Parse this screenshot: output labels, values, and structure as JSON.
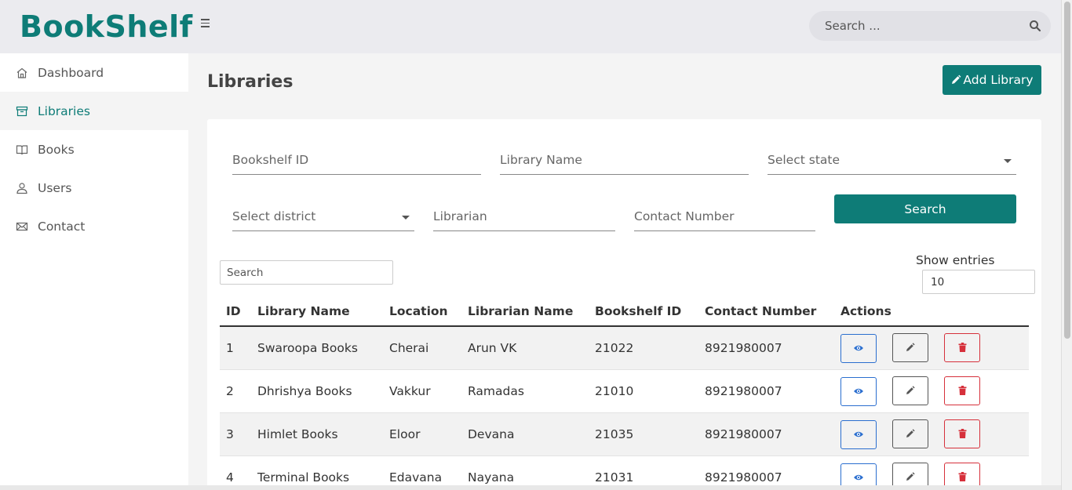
{
  "app": {
    "logo": "BookShelf",
    "brand_color": "#0e7c77"
  },
  "header": {
    "search_placeholder": "Search ..."
  },
  "sidebar": {
    "items": [
      {
        "label": "Dashboard",
        "icon": "home-icon",
        "active": false
      },
      {
        "label": "Libraries",
        "icon": "archive-icon",
        "active": true
      },
      {
        "label": "Books",
        "icon": "book-icon",
        "active": false
      },
      {
        "label": "Users",
        "icon": "user-icon",
        "active": false
      },
      {
        "label": "Contact",
        "icon": "mail-icon",
        "active": false
      }
    ]
  },
  "page": {
    "title": "Libraries",
    "add_button": "Add Library"
  },
  "filters": {
    "bookshelf_id": "Bookshelf ID",
    "library_name": "Library Name",
    "state": "Select state",
    "district": "Select district",
    "librarian": "Librarian",
    "contact": "Contact Number",
    "search_button": "Search"
  },
  "table_controls": {
    "search_placeholder": "Search",
    "show_entries_label": "Show entries",
    "show_entries_value": "10"
  },
  "table": {
    "columns": [
      "ID",
      "Library Name",
      "Location",
      "Librarian Name",
      "Bookshelf ID",
      "Contact Number",
      "Actions"
    ],
    "rows": [
      [
        "1",
        "Swaroopa Books",
        "Cherai",
        "Arun VK",
        "21022",
        "8921980007"
      ],
      [
        "2",
        "Dhrishya Books",
        "Vakkur",
        "Ramadas",
        "21010",
        "8921980007"
      ],
      [
        "3",
        "Himlet Books",
        "Eloor",
        "Devana",
        "21035",
        "8921980007"
      ],
      [
        "4",
        "Terminal Books",
        "Edavana",
        "Nayana",
        "21031",
        "8921980007"
      ]
    ]
  }
}
